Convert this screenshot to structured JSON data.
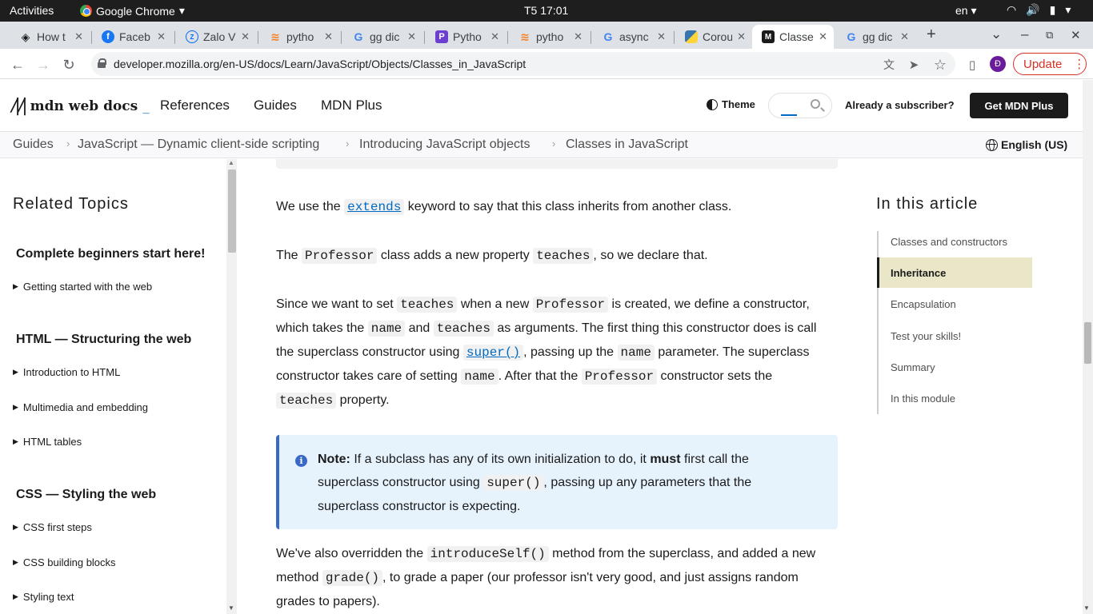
{
  "system": {
    "activities": "Activities",
    "app_name": "Google Chrome",
    "clock": "T5 17:01",
    "lang": "en ▾"
  },
  "tabs": [
    {
      "title": "How t",
      "favicon": "codecademy-icon",
      "color": "#1b1b1b"
    },
    {
      "title": "Faceb",
      "favicon": "facebook-icon",
      "color": "#1877f2"
    },
    {
      "title": "Zalo V",
      "favicon": "zalo-icon",
      "color": "#0068ff"
    },
    {
      "title": "pytho",
      "favicon": "stackoverflow-icon",
      "color": "#f48024"
    },
    {
      "title": "gg dic",
      "favicon": "google-icon",
      "color": "#4285f4"
    },
    {
      "title": "Pytho",
      "favicon": "p-icon",
      "color": "#6c3fd1"
    },
    {
      "title": "pytho",
      "favicon": "stackoverflow-icon",
      "color": "#f48024"
    },
    {
      "title": "async",
      "favicon": "google-icon",
      "color": "#4285f4"
    },
    {
      "title": "Corou",
      "favicon": "python-icon",
      "color": "#3776ab"
    },
    {
      "title": "Classe",
      "favicon": "mdn-icon",
      "color": "#1b1b1b"
    },
    {
      "title": "gg dic",
      "favicon": "google-icon",
      "color": "#4285f4"
    }
  ],
  "toolbar": {
    "url": "developer.mozilla.org/en-US/docs/Learn/JavaScript/Objects/Classes_in_JavaScript",
    "profile_initial": "Đ",
    "update_label": "Update"
  },
  "mdn": {
    "logo": "mdn web docs",
    "nav": [
      "References",
      "Guides",
      "MDN Plus"
    ],
    "theme": "Theme",
    "subscriber": "Already a subscriber?",
    "get_plus": "Get MDN Plus"
  },
  "breadcrumbs": [
    "Guides",
    "JavaScript — Dynamic client-side scripting",
    "Introducing JavaScript objects",
    "Classes in JavaScript"
  ],
  "language": "English (US)",
  "sidebar": {
    "title": "Related Topics",
    "sections": [
      {
        "heading": "Complete beginners start here!",
        "items": [
          "Getting started with the web"
        ]
      },
      {
        "heading": "HTML — Structuring the web",
        "items": [
          "Introduction to HTML",
          "Multimedia and embedding",
          "HTML tables"
        ]
      },
      {
        "heading": "CSS — Styling the web",
        "items": [
          "CSS first steps",
          "CSS building blocks",
          "Styling text"
        ]
      }
    ]
  },
  "article": {
    "p1": {
      "a": "We use the ",
      "code": "extends",
      "b": " keyword to say that this class inherits from another class."
    },
    "p2": {
      "a": "The ",
      "code1": "Professor",
      "b": " class adds a new property ",
      "code2": "teaches",
      "c": ", so we declare that."
    },
    "p3": {
      "a": "Since we want to set ",
      "c1": "teaches",
      "b": " when a new ",
      "c2": "Professor",
      "c": " is created, we define a constructor, which takes the ",
      "c3": "name",
      "d": " and ",
      "c4": "teaches",
      "e": " as arguments. The first thing this constructor does is call the superclass constructor using ",
      "c5": "super()",
      "f": ", passing up the ",
      "c6": "name",
      "g": " parameter. The superclass constructor takes care of setting ",
      "c7": "name",
      "h": ". After that the ",
      "c8": "Professor",
      "i": " constructor sets the ",
      "c9": "teaches",
      "j": " property."
    },
    "note": {
      "label": "Note:",
      "a": " If a subclass has any of its own initialization to do, it ",
      "must": "must",
      "b": " first call the superclass constructor using ",
      "code": "super()",
      "c": ", passing up any parameters that the superclass constructor is expecting."
    },
    "p4": {
      "a": "We've also overridden the ",
      "c1": "introduceSelf()",
      "b": " method from the superclass, and added a new method ",
      "c2": "grade()",
      "c": ", to grade a paper (our professor isn't very good, and just assigns random grades to papers)."
    }
  },
  "toc": {
    "title": "In this article",
    "items": [
      "Classes and constructors",
      "Inheritance",
      "Encapsulation",
      "Test your skills!",
      "Summary",
      "In this module"
    ]
  }
}
